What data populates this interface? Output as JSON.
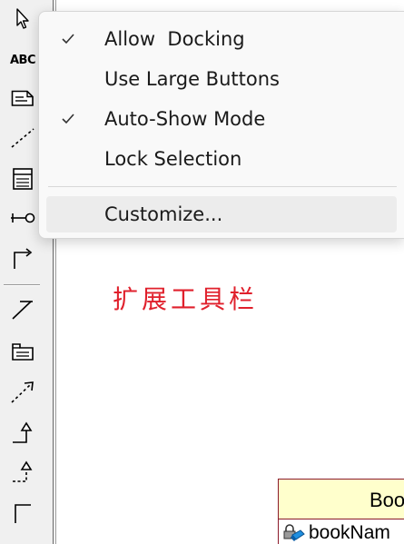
{
  "toolbar": {
    "tools": [
      {
        "icon": "pointer-arrow-icon"
      },
      {
        "icon": "text-icon",
        "text": "ABC"
      },
      {
        "icon": "note-icon"
      },
      {
        "icon": "dashed-line-icon"
      },
      {
        "icon": "class-icon"
      },
      {
        "icon": "interface-lollipop-icon"
      },
      {
        "icon": "elbow-connector-icon"
      },
      {
        "icon": "association-icon"
      },
      {
        "icon": "package-icon"
      },
      {
        "icon": "dependency-arrow-icon"
      },
      {
        "icon": "generalization-icon"
      },
      {
        "icon": "realization-icon"
      },
      {
        "icon": "anchor-corner-icon"
      }
    ]
  },
  "context_menu": {
    "items": [
      {
        "label": "Allow  Docking",
        "checked": true
      },
      {
        "label": "Use Large Buttons",
        "checked": false
      },
      {
        "label": "Auto-Show Mode",
        "checked": true
      },
      {
        "label": "Lock Selection",
        "checked": false
      },
      {
        "label": "Customize...",
        "checked": false,
        "highlighted": true
      }
    ]
  },
  "annotation": {
    "text": "扩展工具栏",
    "color": "#e0202c"
  },
  "uml_class": {
    "name_partial": "Boo",
    "attribute_partial": "bookNam",
    "header_color": "#ffffcc",
    "border_color": "#8b1a2a"
  }
}
